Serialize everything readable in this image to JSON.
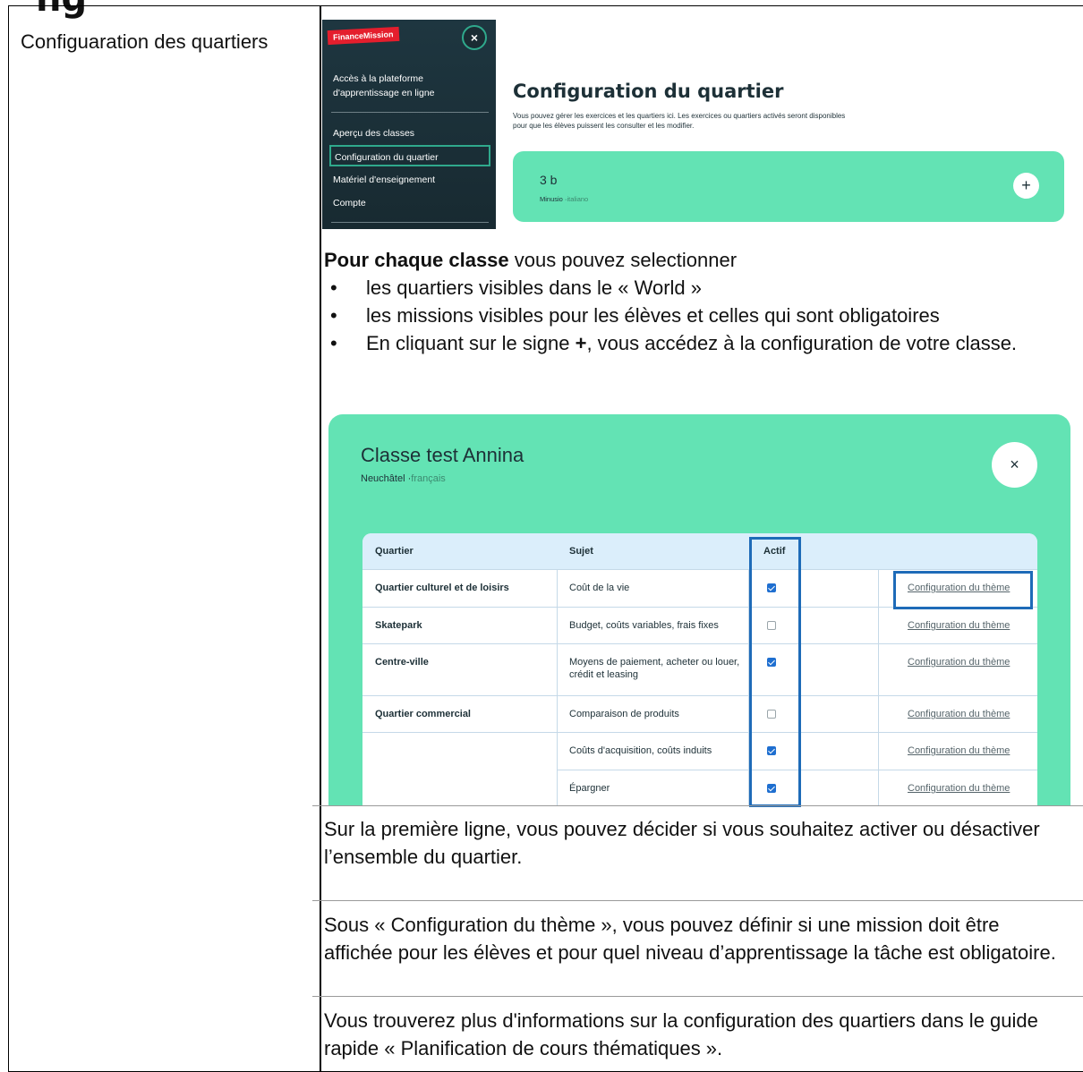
{
  "page_heading_fragment": "ng",
  "left_cell": {
    "title": "Configuaration des quartiers"
  },
  "sidebar": {
    "brand": "FinanceMission",
    "close_glyph": "×",
    "access_label": "Accès à la plateforme d'apprentissage en ligne",
    "items": [
      {
        "label": "Aperçu des classes"
      },
      {
        "label": "Configuration du quartier"
      },
      {
        "label": "Matériel d'enseignement"
      },
      {
        "label": "Compte"
      }
    ]
  },
  "config_page": {
    "title": "Configuration du quartier",
    "description": "Vous pouvez gérer les exercices et les quartiers ici. Les exercices ou quartiers activés seront disponibles pour que les élèves puissent les consulter et les modifier.",
    "class_card": {
      "name": "3 b",
      "location": "Minusio",
      "language": "italiano",
      "plus_glyph": "+"
    }
  },
  "instructions": {
    "intro_bold": "Pour chaque classe",
    "intro_rest": " vous pouvez selectionner",
    "bullets": {
      "b1": "les quartiers visibles dans le « World »",
      "b2": "les missions visibles pour les élèves et celles qui sont obligatoires",
      "b3_pre": "En cliquant sur le signe ",
      "b3_bold": "+",
      "b3_post": ", vous accédez à la configuration de votre classe."
    }
  },
  "modal": {
    "title": "Classe test Annina",
    "location": "Neuchâtel",
    "language": "français",
    "close_glyph": "×",
    "columns": {
      "quartier": "Quartier",
      "sujet": "Sujet",
      "actif": "Actif"
    },
    "rows": [
      {
        "quartier": "Quartier culturel et de loisirs",
        "sujet": "Coût de la vie",
        "actif": true,
        "link": "Configuration du thème"
      },
      {
        "quartier": "Skatepark",
        "sujet": "Budget, coûts variables, frais fixes",
        "actif": false,
        "link": "Configuration du thème"
      },
      {
        "quartier": "Centre-ville",
        "sujet": "Moyens de paiement, acheter ou louer, crédit et leasing",
        "actif": true,
        "link": "Configuration du thème"
      },
      {
        "quartier": "Quartier commercial",
        "sujet": "Comparaison de produits",
        "actif": false,
        "link": "Configuration du thème"
      },
      {
        "quartier": "",
        "sujet": "Coûts d'acquisition, coûts induits",
        "actif": true,
        "link": "Configuration du thème"
      },
      {
        "quartier": "",
        "sujet": "Épargner",
        "actif": true,
        "link": "Configuration du thème"
      }
    ]
  },
  "paragraphs": {
    "p1": "Sur la première ligne, vous pouvez décider si vous souhaitez activer ou désactiver l’ensemble du quartier.",
    "p2": "Sous « Configuration du thème », vous pouvez définir si une mission doit être affichée pour les élèves et pour quel niveau d’apprentissage la tâche est obligatoire.",
    "p3": "Vous trouverez plus d'informations sur la configuration des quartiers dans le guide rapide « Planification de cours thématiques »."
  },
  "colors": {
    "mint": "#63e3b4",
    "dark_panel": "#1e3640",
    "highlight_blue": "#1e6bb8",
    "checkbox_blue": "#1f6fd0",
    "brand_red": "#e41e2d"
  }
}
